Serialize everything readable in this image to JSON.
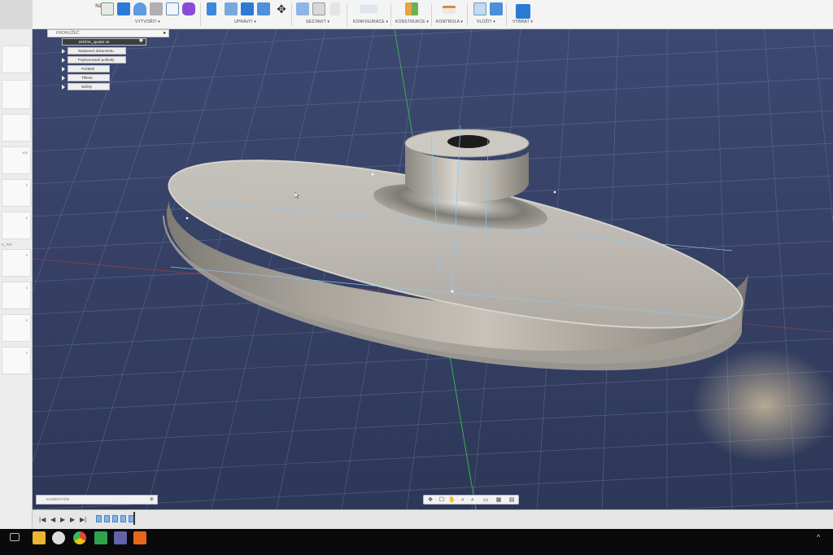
{
  "toolbar": {
    "workspace": "Návrh",
    "groups": [
      {
        "label": "VYTVOŘIT ▾"
      },
      {
        "label": "UPRAVIT ▾"
      },
      {
        "label": "SESTAVIT ▾"
      },
      {
        "label": "KONFIGURACE ▾"
      },
      {
        "label": "KONSTRUKCE ▾"
      },
      {
        "label": "KONTROLA ▾"
      },
      {
        "label": "VLOŽIT ▾"
      },
      {
        "label": "VYBRAT ▾"
      }
    ],
    "icons": [
      "sketch-icon",
      "box-icon",
      "revolve-icon",
      "hole-icon",
      "spline-icon",
      "form-icon",
      "push-pull-icon",
      "fillet-icon",
      "shell-icon",
      "combine-icon",
      "move-icon",
      "joint-icon",
      "rigid-group-icon",
      "ground-icon",
      "parameter-icon",
      "plane-icon",
      "measure-icon",
      "decal-icon",
      "canvas-icon",
      "select-icon"
    ],
    "accent": "#2b7bd6"
  },
  "browser": {
    "header": "PROHLÍŽEČ",
    "root": "DRŽÁK_spodní v6",
    "items": [
      {
        "label": "Nastavení dokumentu"
      },
      {
        "label": "Pojmenované pohledy"
      },
      {
        "label": "Počátek"
      },
      {
        "label": "Tělesa"
      },
      {
        "label": "Náčrty"
      }
    ]
  },
  "left_panel": {
    "values": [
      "100",
      "0",
      "0",
      "0",
      "0",
      "0",
      "0",
      "0"
    ],
    "label": "E_Ref"
  },
  "comments": {
    "label": "KOMENTÁŘE"
  },
  "navbar": {
    "icons": [
      "orbit-icon",
      "pan-icon",
      "look-at-icon",
      "zoom-icon",
      "fit-icon",
      "display-settings-icon",
      "grid-icon",
      "view-icon"
    ]
  },
  "timeline": {
    "controls": [
      "|◀",
      "◀",
      "▶",
      "▶",
      "▶|"
    ],
    "feature_count": 5
  },
  "taskbar": {
    "apps": [
      "task-view-icon",
      "file-explorer-icon",
      "chat-icon",
      "chrome-icon",
      "green-app-icon",
      "calendar-icon",
      "fusion-360-icon"
    ],
    "tray": "^"
  },
  "colors": {
    "viewport_bg": "#354064",
    "grid_line": "#7a86a8",
    "axis_green": "#3cb04a",
    "axis_red": "#b04040",
    "model": "#b8b4ac"
  }
}
